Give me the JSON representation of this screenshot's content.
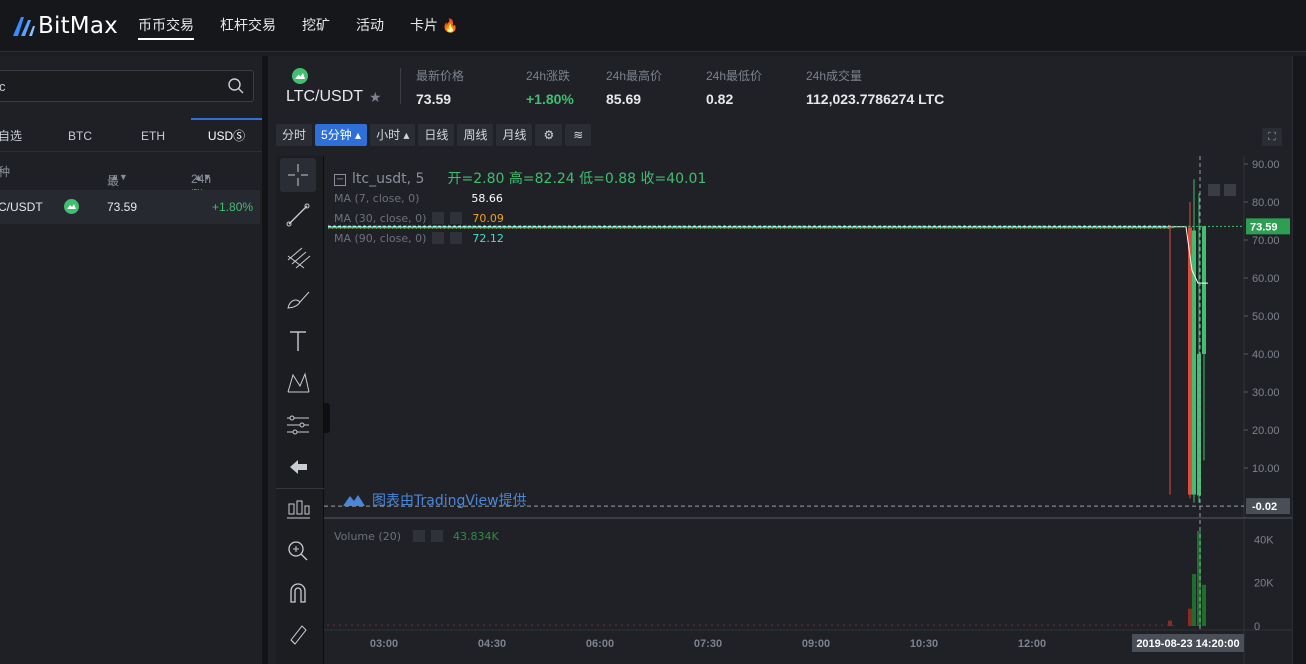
{
  "app": {
    "logo_text": "BitMax",
    "nav": [
      {
        "label": "币币交易",
        "active": true
      },
      {
        "label": "杠杆交易",
        "active": false
      },
      {
        "label": "挖矿",
        "active": false
      },
      {
        "label": "活动",
        "active": false
      },
      {
        "label": "卡片",
        "active": false,
        "icon": "flame-icon"
      }
    ]
  },
  "market": {
    "search": {
      "value": "c",
      "placeholder": ""
    },
    "tabs": [
      {
        "label": "自选",
        "active": false
      },
      {
        "label": "BTC",
        "active": false
      },
      {
        "label": "ETH",
        "active": false
      },
      {
        "label": "USDⓈ",
        "active": true
      }
    ],
    "columns": [
      "种",
      "最新价",
      "24h涨跌"
    ],
    "rows": [
      {
        "pair": "C/USDT",
        "price": "73.59",
        "change": "+1.80%"
      }
    ]
  },
  "ticker": {
    "pair": "LTC/USDT",
    "stats": [
      {
        "label": "最新价格",
        "value": "73.59",
        "up": false
      },
      {
        "label": "24h涨跌",
        "value": "+1.80%",
        "up": true
      },
      {
        "label": "24h最高价",
        "value": "85.69",
        "up": false
      },
      {
        "label": "24h最低价",
        "value": "0.82",
        "up": false
      },
      {
        "label": "24h成交量",
        "value": "112,023.7786274 LTC",
        "up": false
      }
    ]
  },
  "toolbar": {
    "buttons": [
      {
        "label": "分时",
        "active": false
      },
      {
        "label": "5分钟 ▴",
        "active": true
      },
      {
        "label": "小时 ▴",
        "active": false
      },
      {
        "label": "日线",
        "active": false
      },
      {
        "label": "周线",
        "active": false
      },
      {
        "label": "月线",
        "active": false
      },
      {
        "label": "⚙",
        "active": false
      },
      {
        "label": "≋",
        "active": false
      }
    ]
  },
  "legend": {
    "symbol": "ltc_usdt, 5",
    "open_label": "开",
    "open": "2.80",
    "high_label": "高",
    "high": "82.24",
    "low_label": "低",
    "low": "0.88",
    "close_label": "收",
    "close": "40.01",
    "ma7_label": "MA (7, close, 0)",
    "ma7": "58.66",
    "ma30_label": "MA (30, close, 0)",
    "ma30": "70.09",
    "ma90_label": "MA (90, close, 0)",
    "ma90": "72.12",
    "volume_label": "Volume (20)",
    "volume": "43.834K",
    "credit": "图表由TradingView提供"
  },
  "colors": {
    "accent": "#2e6fd8",
    "up": "#3fbf6f",
    "down": "#e14b3b",
    "ma7": "#ffffff",
    "ma30": "#f0a020",
    "ma90": "#3ee0c8"
  },
  "chart_data": {
    "type": "candlestick",
    "price_axis": {
      "ylim": [
        -0.02,
        90
      ],
      "ticks": [
        "90.00",
        "80.00",
        "70.00",
        "60.00",
        "50.00",
        "40.00",
        "30.00",
        "20.00",
        "10.00"
      ]
    },
    "volume_axis": {
      "ticks": [
        "40K",
        "20K",
        "0"
      ]
    },
    "x_ticks": [
      "03:00",
      "04:30",
      "06:00",
      "07:30",
      "09:00",
      "10:30",
      "12:00"
    ],
    "crosshair_time": "2019-08-23 14:20:00",
    "last_price_label": "73.59",
    "crosshair_price_label": "-0.02",
    "flat_level": 73.5,
    "candles": [
      {
        "o": 73.5,
        "h": 73.6,
        "l": 3.0,
        "c": 73.4,
        "v": 2500
      },
      {
        "o": 73.4,
        "h": 73.5,
        "l": 73.2,
        "c": 73.3,
        "v": 400
      },
      {
        "o": 73.3,
        "h": 80,
        "l": 2.0,
        "c": 3.0,
        "v": 8000
      },
      {
        "o": 3.0,
        "h": 86,
        "l": 0.9,
        "c": 72.5,
        "v": 24000
      },
      {
        "o": 2.8,
        "h": 82.24,
        "l": 0.88,
        "c": 40.01,
        "v": 43834
      },
      {
        "o": 40.0,
        "h": 73.7,
        "l": 12.0,
        "c": 73.59,
        "v": 19000
      }
    ]
  }
}
